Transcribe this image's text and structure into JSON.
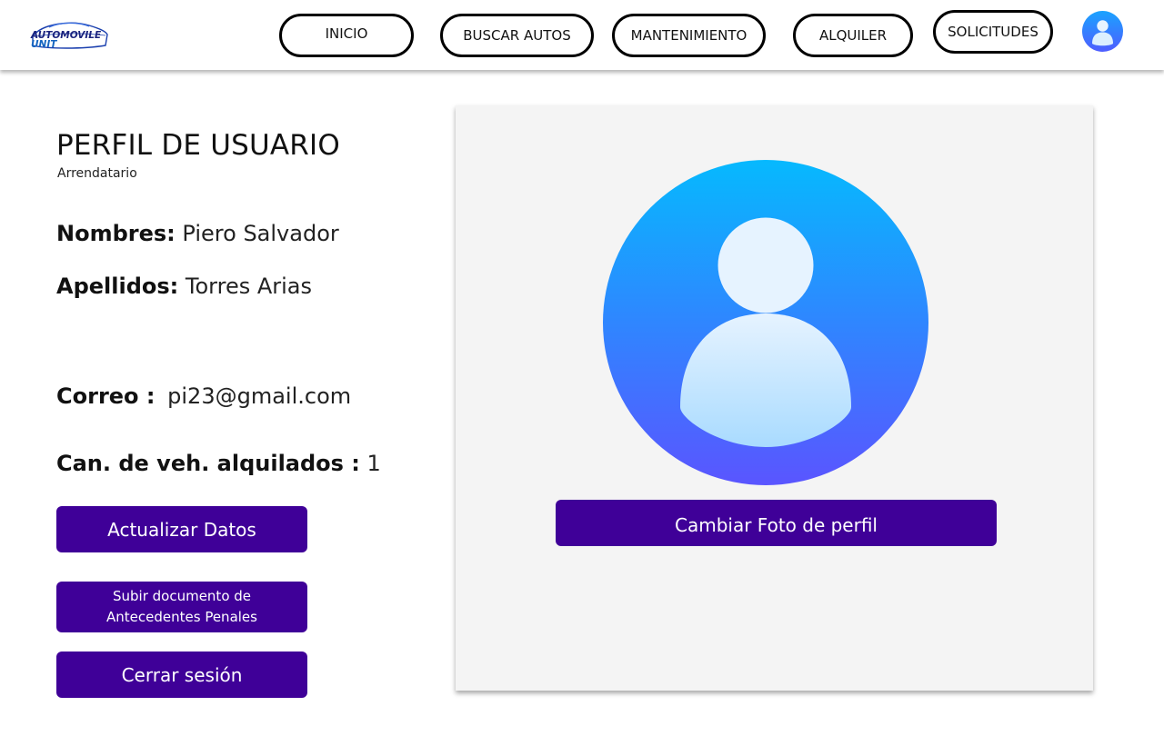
{
  "logo": {
    "line1": "AUTOMOVILE",
    "line2": "UNIT"
  },
  "nav": {
    "items": [
      {
        "label": "INICIO"
      },
      {
        "label": "BUSCAR AUTOS"
      },
      {
        "label": "MANTENIMIENTO"
      },
      {
        "label": "ALQUILER"
      },
      {
        "label": "SOLICITUDES"
      }
    ],
    "avatar_icon": "user-avatar-icon"
  },
  "profile": {
    "title": "PERFIL DE USUARIO",
    "role": "Arrendatario",
    "nombres_label": "Nombres:",
    "nombres_value": "Piero Salvador",
    "apellidos_label": "Apellidos:",
    "apellidos_value": "Torres Arias",
    "correo_label": "Correo :",
    "correo_value": "pi23@gmail.com",
    "vehiculos_label": "Can. de veh. alquilados :",
    "vehiculos_value": "1"
  },
  "actions": {
    "update_label": "Actualizar Datos",
    "upload_line1": "Subir documento de",
    "upload_line2": "Antecedentes Penales",
    "logout_label": "Cerrar sesión",
    "change_photo_label": "Cambiar Foto de perfil"
  },
  "colors": {
    "primary_button": "#3f0098",
    "avatar_gradient_top": "#06b9fe",
    "avatar_gradient_bottom": "#5a55ff",
    "panel_background": "#f4f4f4"
  }
}
